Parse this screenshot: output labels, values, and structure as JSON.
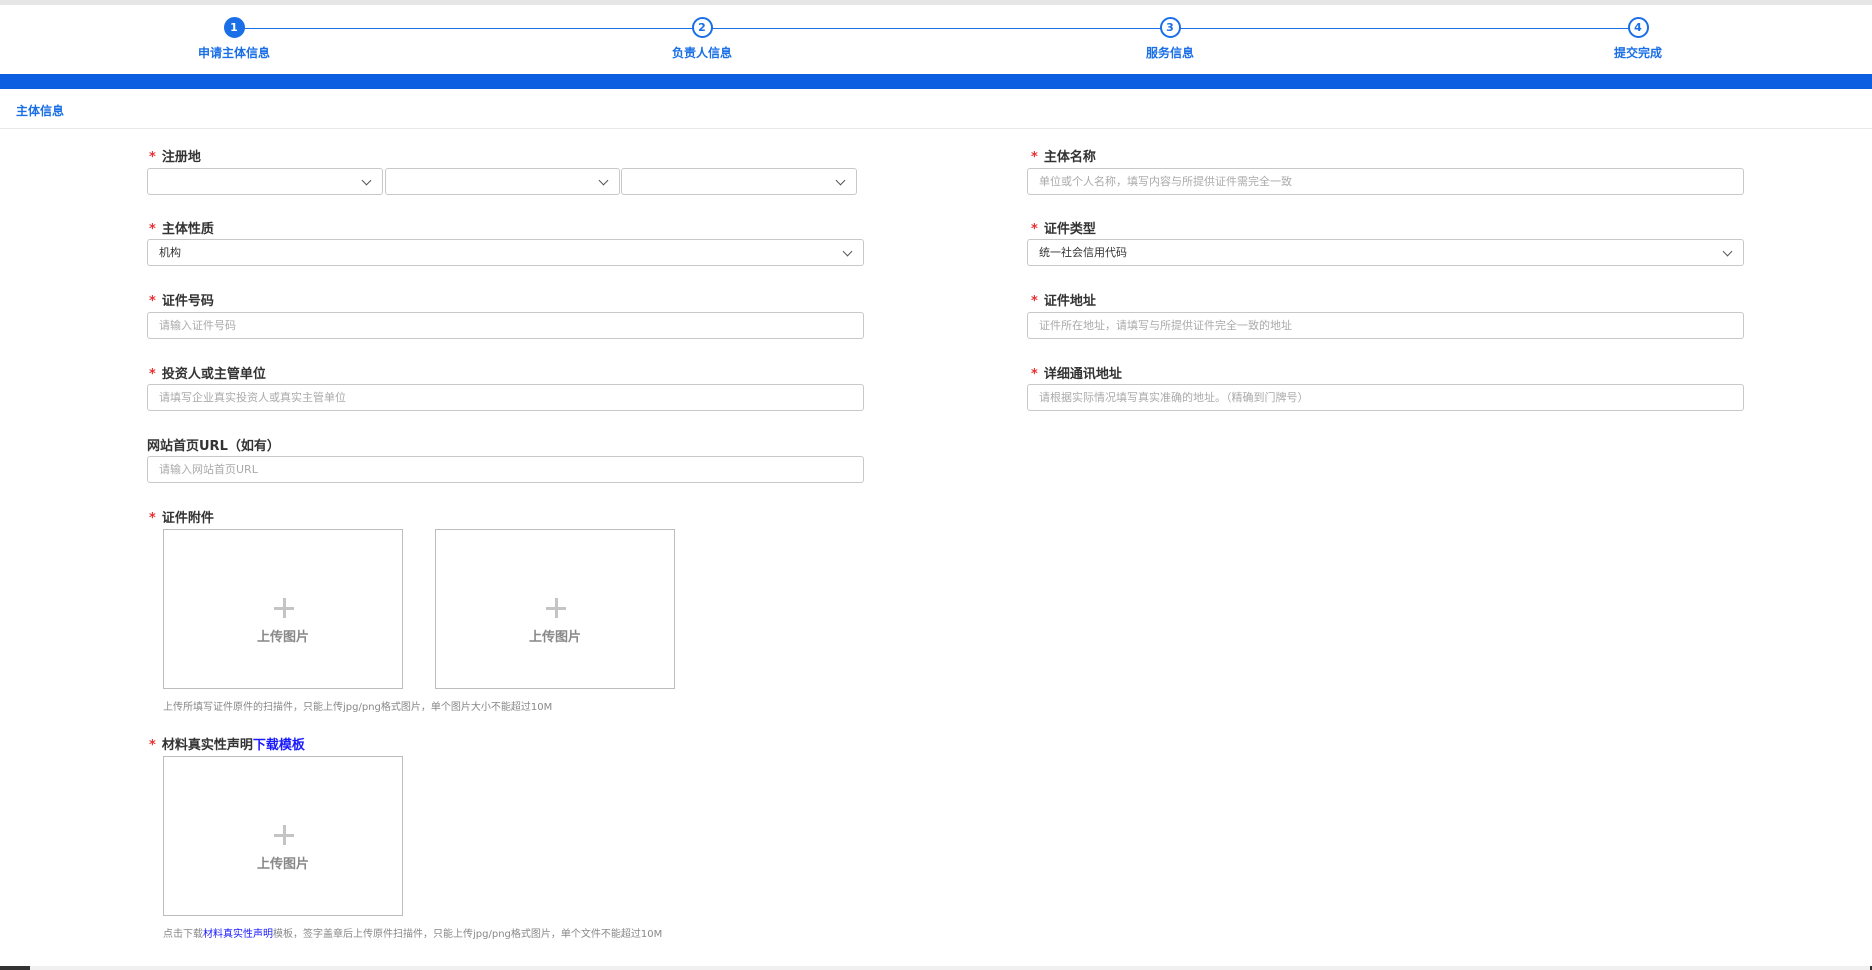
{
  "steps": [
    {
      "num": "1",
      "label": "申请主体信息"
    },
    {
      "num": "2",
      "label": "负责人信息"
    },
    {
      "num": "3",
      "label": "服务信息"
    },
    {
      "num": "4",
      "label": "提交完成"
    }
  ],
  "section": {
    "title": "主体信息"
  },
  "required_mark": "*",
  "fields": {
    "register_place": {
      "label": "注册地"
    },
    "entity_name": {
      "label": "主体名称",
      "placeholder": "单位或个人名称，填写内容与所提供证件需完全一致"
    },
    "entity_nature": {
      "label": "主体性质",
      "value": "机构"
    },
    "cert_type": {
      "label": "证件类型",
      "value": "统一社会信用代码"
    },
    "cert_number": {
      "label": "证件号码",
      "placeholder": "请输入证件号码"
    },
    "cert_address": {
      "label": "证件地址",
      "placeholder": "证件所在地址，请填写与所提供证件完全一致的地址"
    },
    "investor": {
      "label": "投资人或主管单位",
      "placeholder": "请填写企业真实投资人或真实主管单位"
    },
    "contact_address": {
      "label": "详细通讯地址",
      "placeholder": "请根据实际情况填写真实准确的地址。（精确到门牌号）"
    },
    "website": {
      "label": "网站首页URL（如有）",
      "placeholder": "请输入网站首页URL"
    }
  },
  "attachments": {
    "label": "证件附件",
    "upload_label": "上传图片",
    "hint": "上传所填写证件原件的扫描件，只能上传jpg/png格式图片，单个图片大小不能超过10M"
  },
  "declaration": {
    "label": "材料真实性声明",
    "link": "下载模板",
    "upload_label": "上传图片",
    "hint_prefix": "点击下载",
    "hint_link": "材料真实性声明",
    "hint_suffix": "模板，签字盖章后上传原件扫描件，只能上传jpg/png格式图片，单个文件不能超过10M"
  }
}
